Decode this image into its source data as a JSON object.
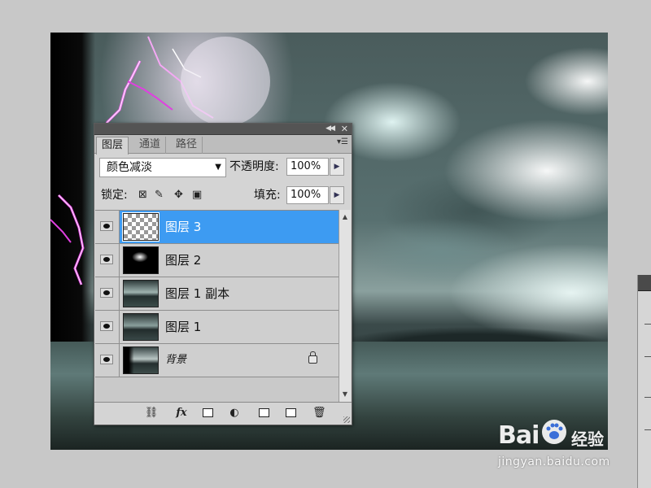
{
  "panel": {
    "tabs": [
      {
        "label": "图层",
        "active": true
      },
      {
        "label": "通道",
        "active": false
      },
      {
        "label": "路径",
        "active": false
      }
    ],
    "blend_mode": "颜色减淡",
    "opacity_label": "不透明度:",
    "opacity_value": "100%",
    "lock_label": "锁定:",
    "fill_label": "填充:",
    "fill_value": "100%",
    "layers": [
      {
        "name": "图层 3",
        "selected": true,
        "visible": true,
        "locked": false
      },
      {
        "name": "图层 2",
        "selected": false,
        "visible": true,
        "locked": false
      },
      {
        "name": "图层 1 副本",
        "selected": false,
        "visible": true,
        "locked": false
      },
      {
        "name": "图层 1",
        "selected": false,
        "visible": true,
        "locked": false
      },
      {
        "name": "背景",
        "selected": false,
        "visible": true,
        "locked": true
      }
    ],
    "bottom_fx_label": "fx"
  },
  "watermark": {
    "brand_left": "Bai",
    "brand_right": "经验",
    "url": "jingyan.baidu.com"
  },
  "colors": {
    "selected_layer": "#3d9bf2",
    "lightning": "#e040e0"
  }
}
